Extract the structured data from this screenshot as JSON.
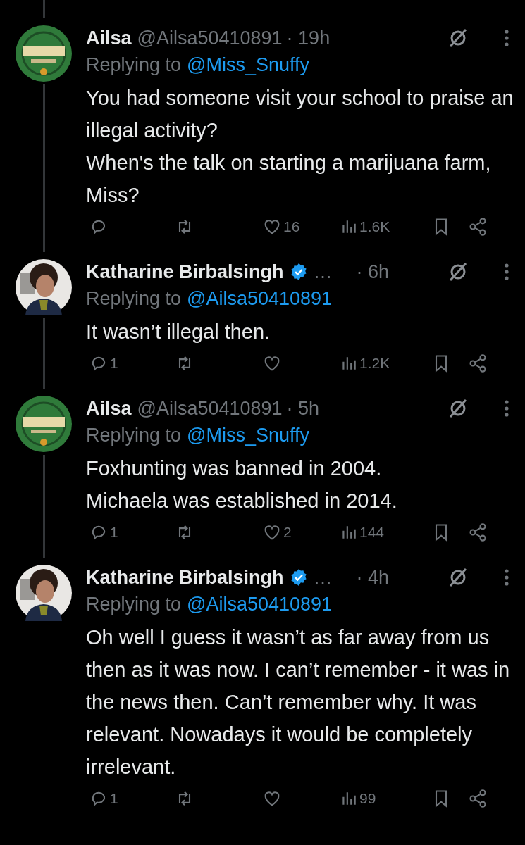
{
  "tweets": [
    {
      "avatar": {
        "kind": "picture"
      },
      "name": "Ailsa",
      "verified": false,
      "handle": "@Ailsa50410891",
      "time": "· 19h",
      "replying_label": "Replying to",
      "replying_to": "@Miss_Snuffy",
      "paragraphs": [
        "You had someone visit your school to praise an illegal activity?",
        "When's the talk on starting a marijuana farm, Miss?"
      ],
      "likes": "16",
      "views": "1.6K"
    },
    {
      "avatar": {
        "kind": "picture"
      },
      "name": "Katharine Birbalsingh",
      "verified": true,
      "handle": "…",
      "time": "· 6h",
      "replying_label": "Replying to",
      "replying_to": "@Ailsa50410891",
      "paragraphs": [
        "It wasn’t illegal then."
      ],
      "replies": "1",
      "views": "1.2K"
    },
    {
      "avatar": {
        "kind": "picture"
      },
      "name": "Ailsa",
      "verified": false,
      "handle": "@Ailsa50410891",
      "time": "· 5h",
      "replying_label": "Replying to",
      "replying_to": "@Miss_Snuffy",
      "paragraphs": [
        "Foxhunting was banned in 2004.",
        "Michaela was established in 2014."
      ],
      "replies": "1",
      "likes": "2",
      "views": "144"
    },
    {
      "avatar": {
        "kind": "picture"
      },
      "name": "Katharine Birbalsingh",
      "verified": true,
      "handle": "…",
      "time": "· 4h",
      "replying_label": "Replying to",
      "replying_to": "@Ailsa50410891",
      "paragraphs": [
        "Oh well I guess it wasn’t as far away from us then as it was now. I can’t remember - it was in the news then. Can’t remember why. It was relevant. Nowadays it would be completely irrelevant."
      ],
      "replies": "1",
      "views": "99"
    }
  ]
}
